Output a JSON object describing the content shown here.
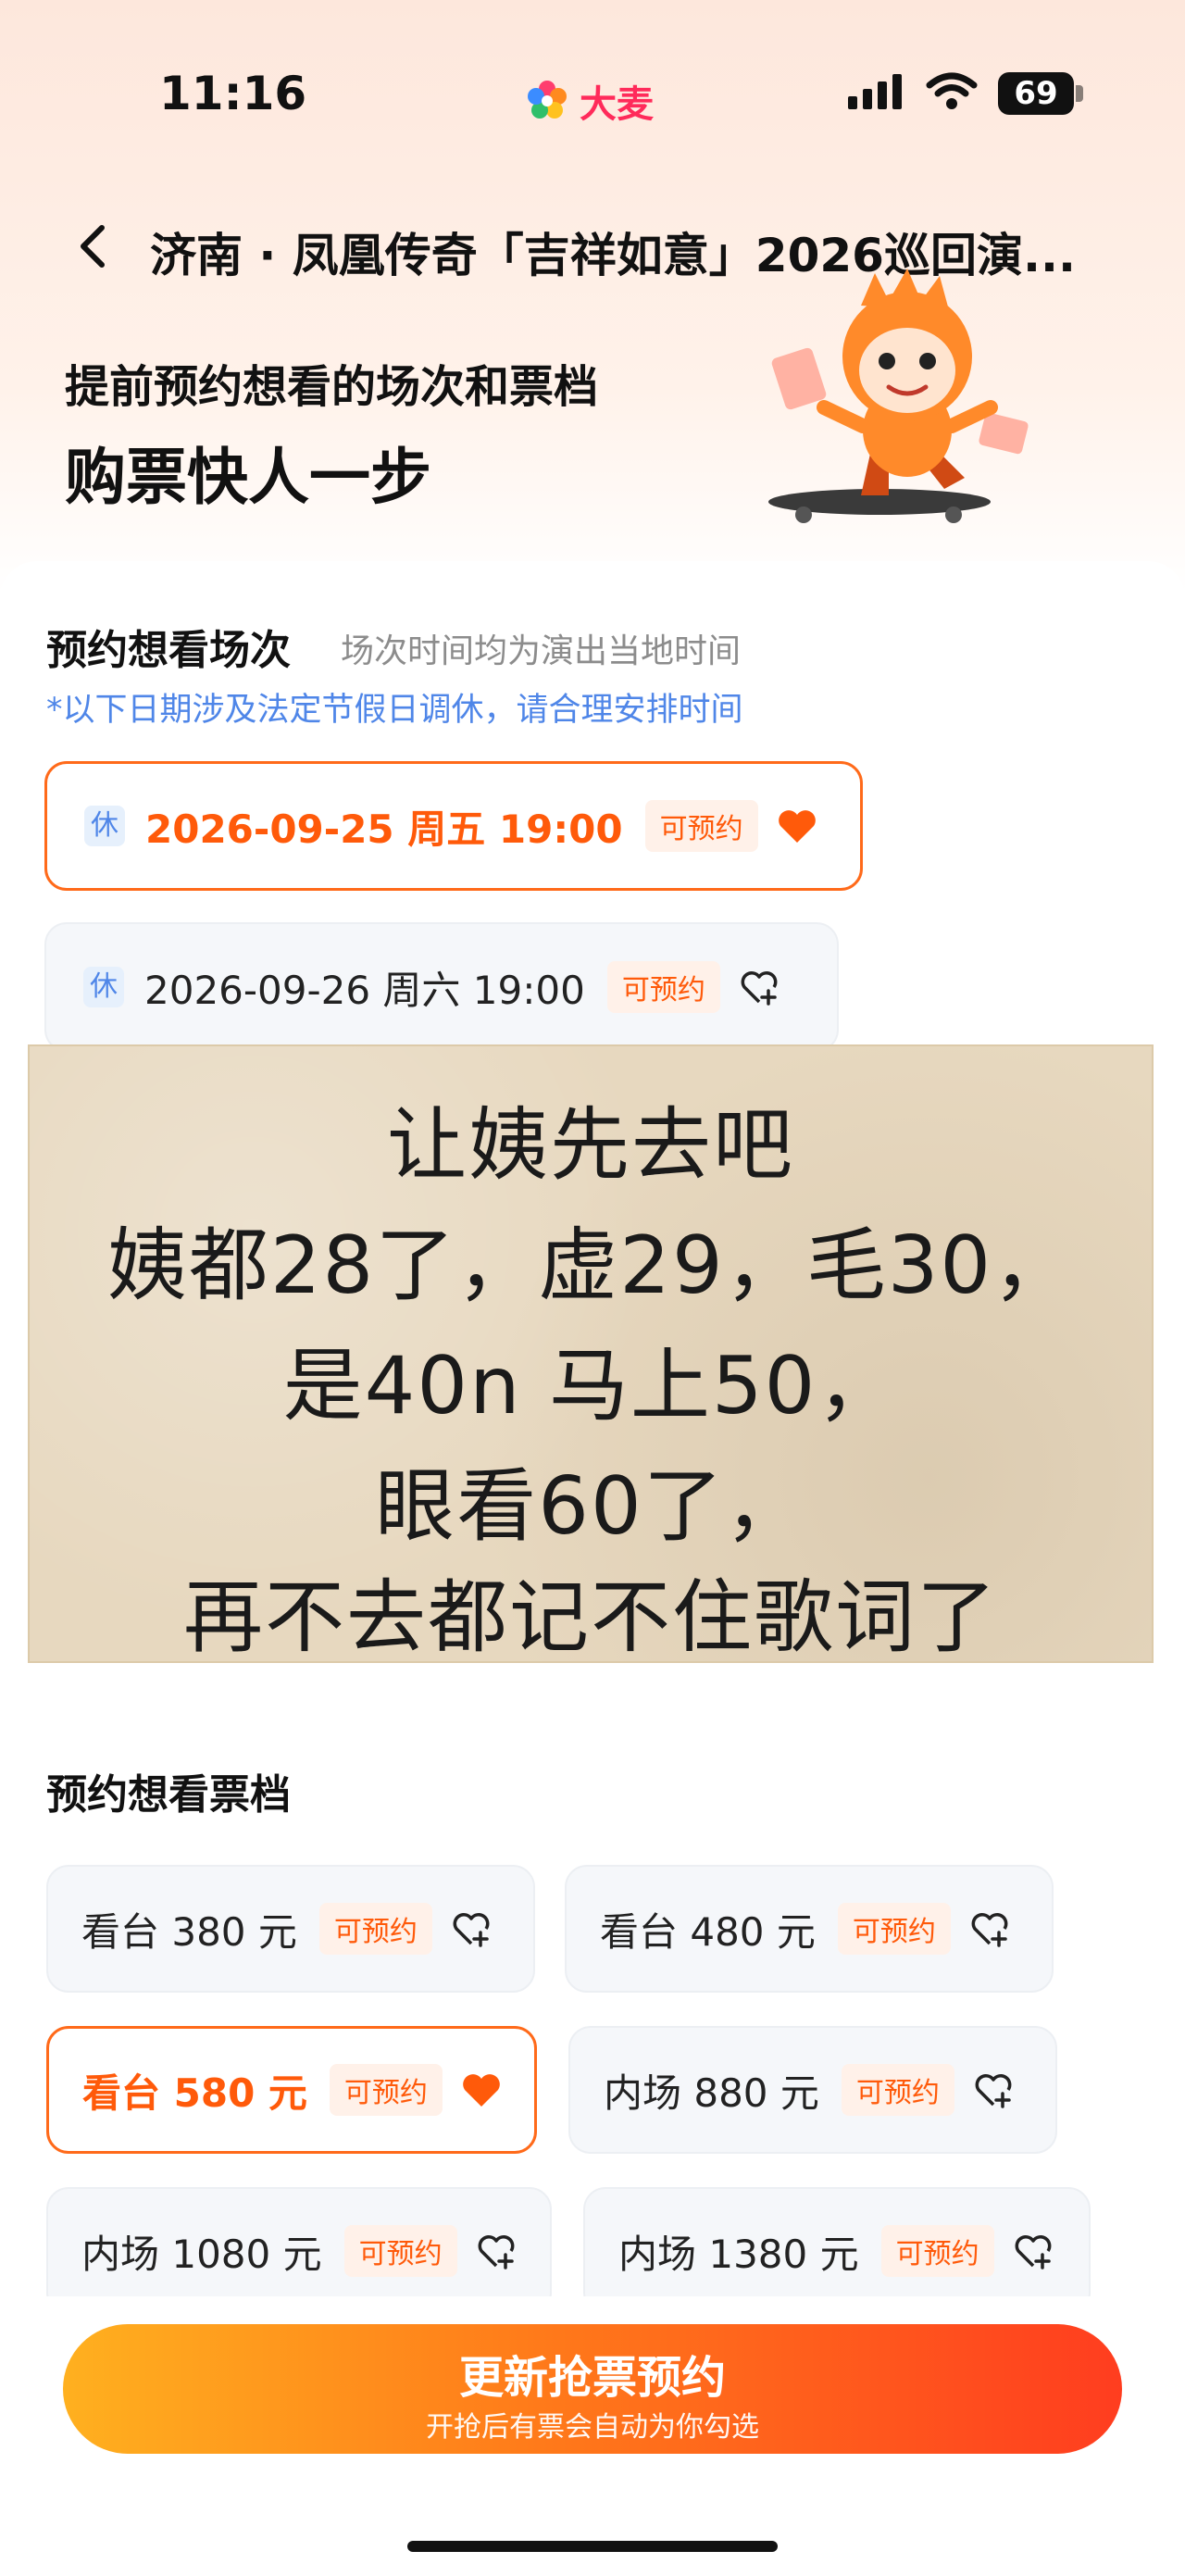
{
  "status_bar": {
    "time": "11:16",
    "battery": "69"
  },
  "app": {
    "brand": "大麦"
  },
  "nav": {
    "title": "济南 · 凤凰传奇「吉祥如意」2026巡回演..."
  },
  "promo": {
    "line1": "提前预约想看的场次和票档",
    "line2": "购票快人一步"
  },
  "sessions": {
    "title": "预约想看场次",
    "subtitle": "场次时间均为演出当地时间",
    "notice": "*以下日期涉及法定节假日调休，请合理安排时间",
    "items": [
      {
        "badge": "休",
        "label": "2026-09-25 周五 19:00",
        "tag": "可预约",
        "selected": true
      },
      {
        "badge": "休",
        "label": "2026-09-26 周六 19:00",
        "tag": "可预约",
        "selected": false
      }
    ]
  },
  "note": {
    "lines": [
      "让姨先去吧",
      "姨都28了，虚29，毛30，",
      "是40n 马上50，",
      "眼看60了，",
      "再不去都记不住歌词了"
    ]
  },
  "tickets": {
    "title": "预约想看票档",
    "items": [
      {
        "label": "看台 380 元",
        "tag": "可预约",
        "selected": false
      },
      {
        "label": "看台 480 元",
        "tag": "可预约",
        "selected": false
      },
      {
        "label": "看台 580 元",
        "tag": "可预约",
        "selected": true
      },
      {
        "label": "内场 880 元",
        "tag": "可预约",
        "selected": false
      },
      {
        "label": "内场 1080 元",
        "tag": "可预约",
        "selected": false
      },
      {
        "label": "内场 1380 元",
        "tag": "可预约",
        "selected": false
      }
    ]
  },
  "cta": {
    "main": "更新抢票预约",
    "sub": "开抢后有票会自动为你勾选"
  },
  "colors": {
    "accent": "#ff5a0a",
    "notice_blue": "#4f86e8"
  }
}
